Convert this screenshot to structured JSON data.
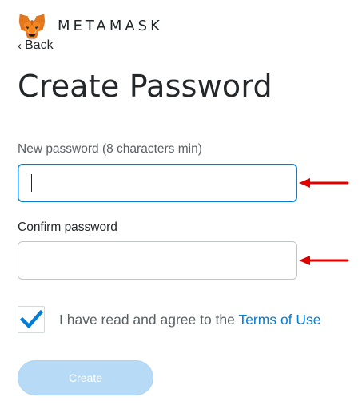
{
  "header": {
    "logo_icon": "metamask-fox-icon",
    "brand_name": "METAMASK",
    "back_label": "Back",
    "back_icon": "chevron-left-icon"
  },
  "form": {
    "title": "Create Password",
    "new_password": {
      "label": "New password (8 characters min)",
      "value": ""
    },
    "confirm_password": {
      "label": "Confirm password",
      "value": ""
    },
    "terms": {
      "checked": true,
      "text": "I have read and agree to the",
      "link_text": "Terms of Use"
    },
    "submit_label": "Create",
    "submit_enabled": false
  },
  "annotations": {
    "arrow_color": "#e00000",
    "arrow_icon": "red-arrow-left-icon"
  },
  "colors": {
    "accent": "#037dd6",
    "text": "#24272a",
    "button_disabled": "#b7dbf6"
  }
}
